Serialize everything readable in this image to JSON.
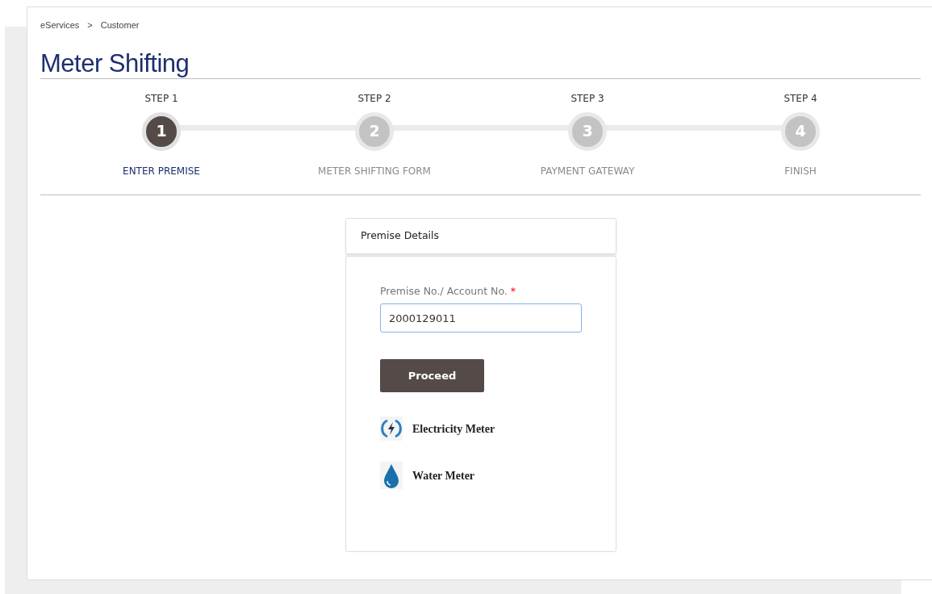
{
  "breadcrumb": [
    {
      "label": "eServices"
    },
    {
      "label": "Customer"
    }
  ],
  "breadcrumb_separator": ">",
  "title": "Meter Shifting",
  "steps": [
    {
      "step": "STEP 1",
      "number": "1",
      "caption": "ENTER PREMISE",
      "selected": true
    },
    {
      "step": "STEP 2",
      "number": "2",
      "caption": "METER SHIFTING FORM",
      "selected": false
    },
    {
      "step": "STEP 3",
      "number": "3",
      "caption": "PAYMENT GATEWAY",
      "selected": false
    },
    {
      "step": "STEP 4",
      "number": "4",
      "caption": "FINISH",
      "selected": false
    }
  ],
  "card": {
    "header": "Premise Details",
    "field": {
      "label": "Premise No./ Account No.",
      "required_mark": "*",
      "value": "2000129011"
    },
    "button": "Proceed",
    "meters": [
      {
        "kind": "electricity",
        "label": "Electricity Meter"
      },
      {
        "kind": "water",
        "label": "Water Meter"
      }
    ]
  }
}
